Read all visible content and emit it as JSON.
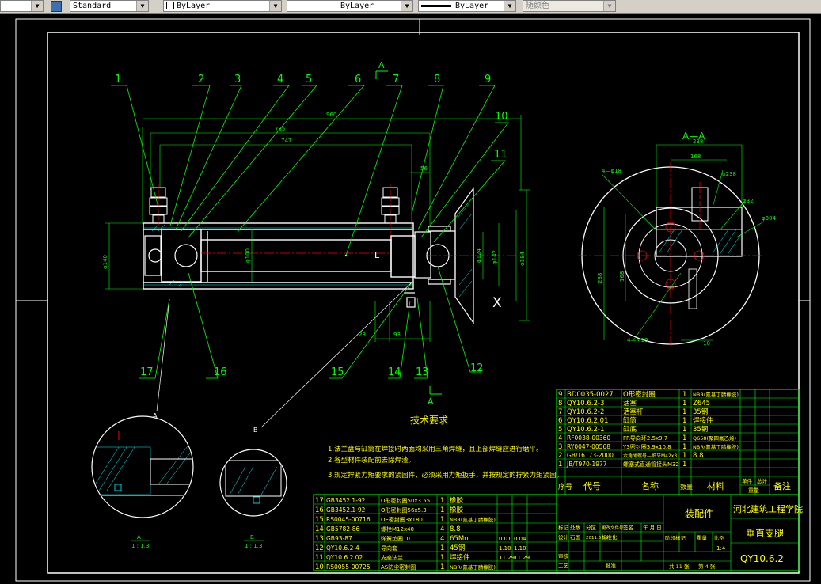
{
  "toolbar": {
    "text_style": "Standard",
    "layer_color": "ByLayer",
    "linetype": "ByLayer",
    "lineweight": "ByLayer",
    "plot_style": "随颜色"
  },
  "drawing": {
    "section_label_top": "A",
    "section_label_bottom": "A",
    "section_title": "A—A",
    "balloons": [
      "1",
      "2",
      "3",
      "4",
      "5",
      "6",
      "7",
      "8",
      "9",
      "10",
      "11",
      "12",
      "13",
      "14",
      "15",
      "16",
      "17"
    ],
    "dimensions": {
      "overall": "960",
      "d785": "785",
      "d747": "747",
      "d56": "56",
      "d28": "28",
      "d93": "93",
      "phi100": "φ100",
      "phi124": "φ124",
      "phi142": "φ142",
      "phi184": "φ184",
      "phi140": "φ140",
      "aa_238": "238",
      "aa_168": "168",
      "aa_phi238": "φ238",
      "aa_phi304": "φ304",
      "aa_phi32": "φ32",
      "aa_4phi18": "4—φ18",
      "aa_4m10": "4—M10",
      "aa_v238": "238",
      "aa_v168": "168",
      "aa_10": "10"
    },
    "marker_x": "X",
    "marker_l": "L",
    "detail_a": "A",
    "detail_b": "B",
    "detail_a_scale": "1 : 1.3",
    "detail_b_scale": "1 : 1.3"
  },
  "tech_requirements": {
    "title": "技术要求",
    "lines": [
      "1.法兰盘与缸筒在焊接时两面均采用三角焊缝，且上部焊缝应进行磨平。",
      "2.各型材件装配前去除焊渣。",
      "3.规定拧紧力矩要求的紧固件，必须采用力矩扳手，并按规定的拧紧力矩紧固。"
    ]
  },
  "bom_upper": {
    "rows": [
      {
        "no": "9",
        "code": "BD0035-0027",
        "name": "O形密封圈",
        "qty": "1",
        "mat": "NBR(氰基丁腈橡胶)"
      },
      {
        "no": "8",
        "code": "QY10.6.2-3",
        "name": "活塞",
        "qty": "1",
        "mat": "Z645"
      },
      {
        "no": "7",
        "code": "QY10.6.2-2",
        "name": "活塞杆",
        "qty": "1",
        "mat": "35钢"
      },
      {
        "no": "6",
        "code": "QY10.6.2.01",
        "name": "缸筒",
        "qty": "1",
        "mat": "焊接件"
      },
      {
        "no": "5",
        "code": "QY10.6.2-1",
        "name": "缸底",
        "qty": "1",
        "mat": "35钢"
      },
      {
        "no": "4",
        "code": "RF0038-00360",
        "name": "FR导向环2.5x9.7",
        "qty": "1",
        "mat": "Q658(聚四氟乙烯)"
      },
      {
        "no": "3",
        "code": "RY0047-00568",
        "name": "Y3密封圈3.9x10.8",
        "qty": "1",
        "mat": "NBR(氰基丁腈橡胶)"
      },
      {
        "no": "2",
        "code": "GB/T6173-2000",
        "name": "六角薄螺母—细牙M42x3",
        "qty": "1",
        "mat": "8.8"
      },
      {
        "no": "1",
        "code": "JB/T970-1977",
        "name": "螺塞式直通管接头M32",
        "qty": "1",
        "mat": ""
      }
    ],
    "headers": {
      "no": "序号",
      "code": "代号",
      "name": "名称",
      "qty": "数量",
      "mat": "材料",
      "unit_w": "单件",
      "total_w": "总计",
      "weight": "重量",
      "remark": "备注"
    }
  },
  "bom_lower": {
    "rows": [
      {
        "no": "17",
        "code": "GB3452.1-92",
        "name": "O形密封圈50x3.55",
        "qty": "1",
        "mat": "橡胶",
        "w1": "",
        "w2": ""
      },
      {
        "no": "16",
        "code": "GB3452.1-92",
        "name": "O形密封圈56x5.3",
        "qty": "1",
        "mat": "橡胶",
        "w1": "",
        "w2": ""
      },
      {
        "no": "15",
        "code": "RS0045-00716",
        "name": "OE密封圈3x180",
        "qty": "1",
        "mat": "NBR(氰基丁腈橡胶)",
        "w1": "",
        "w2": ""
      },
      {
        "no": "14",
        "code": "GB5782-86",
        "name": "螺栓M12x40",
        "qty": "4",
        "mat": "8.8",
        "w1": "",
        "w2": ""
      },
      {
        "no": "13",
        "code": "GB93-87",
        "name": "弹簧垫圈10",
        "qty": "4",
        "mat": "65Mn",
        "w1": "0.01",
        "w2": "0.04"
      },
      {
        "no": "12",
        "code": "QY10.6.2-4",
        "name": "导向套",
        "qty": "1",
        "mat": "45钢",
        "w1": "1.10",
        "w2": "1.10"
      },
      {
        "no": "11",
        "code": "QY10.6.2.02",
        "name": "支座法兰",
        "qty": "1",
        "mat": "焊接件",
        "w1": "11.29",
        "w2": "11.29"
      },
      {
        "no": "10",
        "code": "RS0055-00725",
        "name": "AS防尘密封圈",
        "qty": "1",
        "mat": "NBR(氰基丁腈橡胶)",
        "w1": "",
        "w2": ""
      }
    ]
  },
  "title_block": {
    "drawing_type": "装配件",
    "institution": "河北建筑工程学院",
    "drawing_name": "垂直支腿",
    "drawing_no": "QY10.6.2",
    "scale": "1:4",
    "sheet_total": "共 11 张",
    "sheet_no": "第 4 张",
    "designer_label": "设计",
    "designer_name": "石国",
    "date": "2011.6.09",
    "std_label": "标准化",
    "marker_label": "标记",
    "count_label": "处数",
    "zone_label": "分区",
    "change_doc_label": "更改文件号",
    "sign_label": "签名",
    "ymd_label": "年.月.日",
    "stage_label": "阶段标记",
    "weight_label": "重量",
    "scale_label": "比例",
    "review_label": "审核",
    "process_label": "工艺",
    "approve_label": "批准"
  },
  "colors": {
    "background": "#000000",
    "outline": "#ffffff",
    "dimension": "#00ff00",
    "hatch": "#00ffff",
    "center": "#ff0000",
    "leader": "#00ff00",
    "tech_text": "#ffff00",
    "table_text": "#ffff00",
    "table_line": "#00ff00"
  }
}
